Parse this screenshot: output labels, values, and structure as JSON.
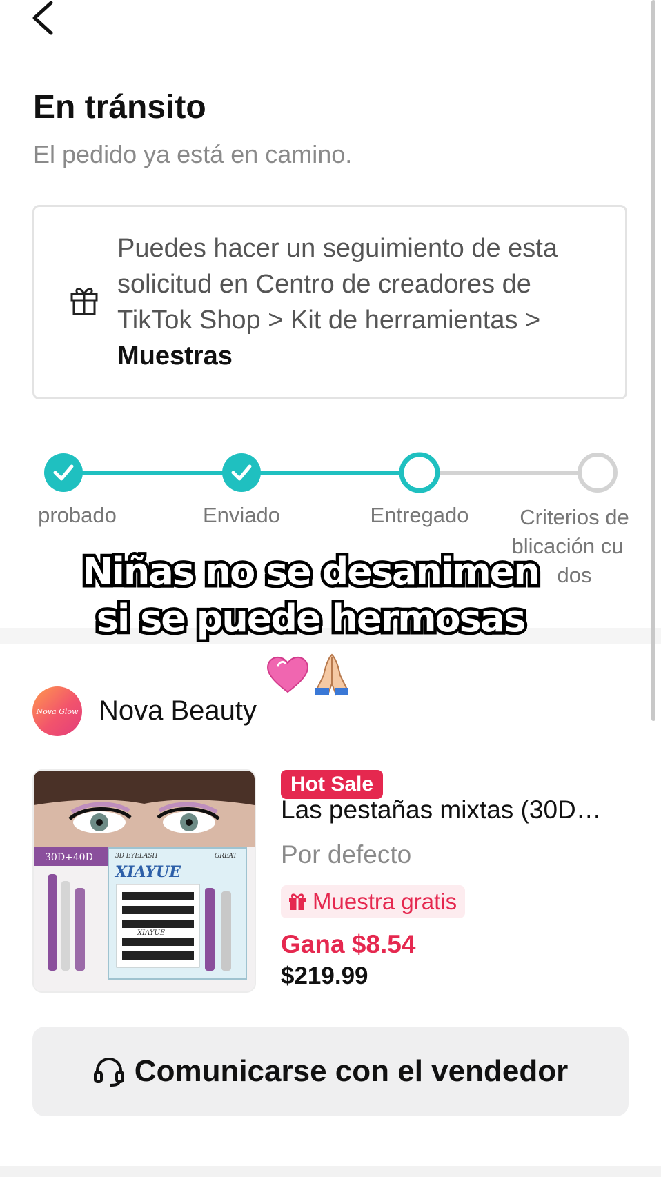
{
  "header": {
    "back_icon": "chevron-left-icon",
    "title": "En tránsito",
    "subtitle": "El pedido ya está en camino."
  },
  "info_card": {
    "icon": "gift-icon",
    "text": "Puedes hacer un seguimiento de esta solicitud en Centro de creadores de TikTok Shop > Kit de herramientas > ",
    "bold_text": "Muestras"
  },
  "progress": {
    "accent_color": "#1fc0c0",
    "inactive_color": "#d3d3d3",
    "steps": [
      {
        "label": "Aprobado",
        "shown_label": "probado",
        "status": "done"
      },
      {
        "label": "Enviado",
        "shown_label": "Enviado",
        "status": "done"
      },
      {
        "label": "Entregado",
        "shown_label": "Entregado",
        "status": "current"
      },
      {
        "label": "Criterios de publicación cumplidos",
        "shown_label": "Criterios de\npublicación cumplidos",
        "status": "pending"
      }
    ],
    "step4_line1": "Criterios de",
    "step4_line2": "blicación cu",
    "step4_line3": "dos"
  },
  "overlay_caption": {
    "line1": "Niñas no se desanimen",
    "line2": "si se puede hermosas",
    "emojis": "💗🙏🏼"
  },
  "shop": {
    "logo_text": "Nova Glow",
    "name": "Nova Beauty"
  },
  "product": {
    "image_labels": {
      "top": "3D EYELASH",
      "brand": "XIAYUE",
      "tag": "GREAT",
      "size": "30D+40D",
      "tray_brand": "XIAYUE"
    },
    "hot_badge": "Hot Sale",
    "name": "Las pestañas mixtas (30D…",
    "variant": "Por defecto",
    "sample_badge": "Muestra gratis",
    "earn": "Gana $8.54",
    "price": "$219.99",
    "brand_color": "#e5284f"
  },
  "contact_button": {
    "icon": "headset-icon",
    "label": "Comunicarse con el vendedor"
  }
}
